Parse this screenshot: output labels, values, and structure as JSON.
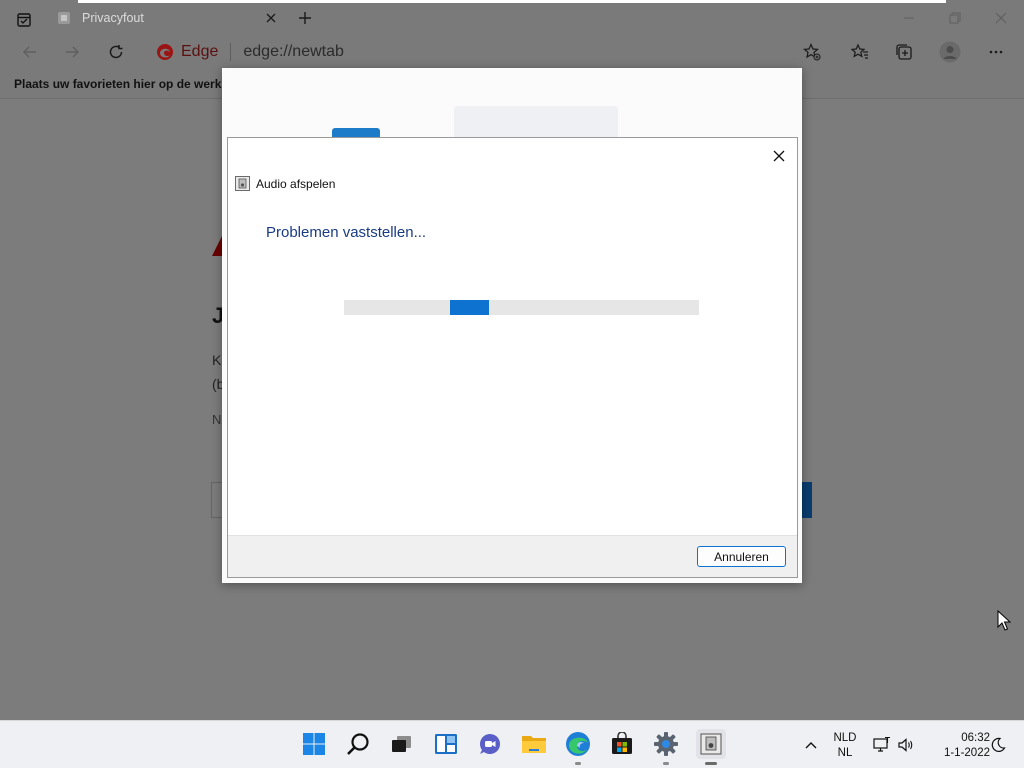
{
  "browser": {
    "tab_title": "Privacyfout",
    "brand_label": "Edge",
    "url": "edge://newtab",
    "favorites_bar_text": "Plaats uw favorieten hier op de werkba"
  },
  "page": {
    "heading_partial": "J",
    "line1_partial": "K",
    "line2_partial": "(b",
    "line3_partial": "N"
  },
  "dialog": {
    "app_title": "Audio afspelen",
    "status_heading": "Problemen vaststellen...",
    "progress_indeterminate": true,
    "cancel_label": "Annuleren"
  },
  "taskbar": {
    "language_line1": "NLD",
    "language_line2": "NL",
    "time": "06:32",
    "date": "1-1-2022"
  },
  "colors": {
    "accent": "#0e72d1",
    "heading_blue": "#1a3b84",
    "edge_red": "#9b1414",
    "dimmed_bg": "#7c7c7c"
  }
}
